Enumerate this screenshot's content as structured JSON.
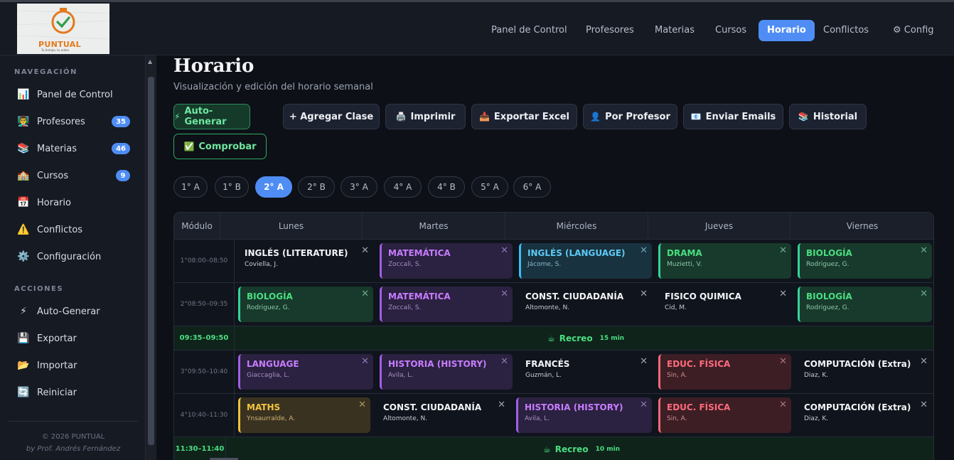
{
  "brand": {
    "name": "PUNTUAL",
    "tagline": "Tu tiempo, tu orden"
  },
  "topnav": [
    {
      "label": "Panel de Control",
      "active": false
    },
    {
      "label": "Profesores",
      "active": false
    },
    {
      "label": "Materias",
      "active": false
    },
    {
      "label": "Cursos",
      "active": false
    },
    {
      "label": "Horario",
      "active": true
    },
    {
      "label": "Conflictos",
      "active": false
    }
  ],
  "config": {
    "label": "Config",
    "icon": "gear-icon"
  },
  "sidebar": {
    "nav_title": "NAVEGACIÓN",
    "nav": [
      {
        "label": "Panel de Control",
        "icon": "chart-icon"
      },
      {
        "label": "Profesores",
        "icon": "teacher-icon",
        "badge": "35"
      },
      {
        "label": "Materias",
        "icon": "books-icon",
        "badge": "46"
      },
      {
        "label": "Cursos",
        "icon": "school-icon",
        "badge": "9"
      },
      {
        "label": "Horario",
        "icon": "calendar-icon"
      },
      {
        "label": "Conflictos",
        "icon": "warning-icon"
      },
      {
        "label": "Configuración",
        "icon": "gear-icon"
      }
    ],
    "actions_title": "ACCIONES",
    "actions": [
      {
        "label": "Auto-Generar",
        "icon": "lightning-icon"
      },
      {
        "label": "Exportar",
        "icon": "floppy-disk-icon"
      },
      {
        "label": "Importar",
        "icon": "folder-icon"
      },
      {
        "label": "Reiniciar",
        "icon": "refresh-icon"
      }
    ],
    "footer": {
      "copyright": "© 2026 PUNTUAL",
      "author": "by Prof. Andrés Fernández"
    }
  },
  "page": {
    "title": "Horario",
    "subtitle": "Visualización y edición del horario semanal"
  },
  "toolbar": [
    {
      "label": "Auto-Generar",
      "icon": "⚡",
      "style": "green"
    },
    {
      "label": "+ Agregar Clase",
      "icon": "",
      "style": "dark"
    },
    {
      "label": "Imprimir",
      "icon": "🖨️",
      "style": "dark"
    },
    {
      "label": "Exportar Excel",
      "icon": "📥",
      "style": "dark"
    },
    {
      "label": "Por Profesor",
      "icon": "👤",
      "style": "dark"
    },
    {
      "label": "Enviar Emails",
      "icon": "📧",
      "style": "dark"
    },
    {
      "label": "Historial",
      "icon": "📚",
      "style": "dark"
    },
    {
      "label": "Comprobar",
      "icon": "✅",
      "style": "greenout"
    }
  ],
  "courses": [
    {
      "label": "1° A",
      "active": false
    },
    {
      "label": "1° B",
      "active": false
    },
    {
      "label": "2° A",
      "active": true
    },
    {
      "label": "2° B",
      "active": false
    },
    {
      "label": "3° A",
      "active": false
    },
    {
      "label": "4° A",
      "active": false
    },
    {
      "label": "4° B",
      "active": false
    },
    {
      "label": "5° A",
      "active": false
    },
    {
      "label": "6° A",
      "active": false
    }
  ],
  "schedule": {
    "module_header": "Módulo",
    "days": [
      "Lunes",
      "Martes",
      "Miércoles",
      "Jueves",
      "Viernes"
    ],
    "rows": [
      {
        "type": "class",
        "time": "1°08:00–08:50",
        "cells": [
          {
            "subject": "INGLÉS (LITERATURE)",
            "teacher": "Coviella, J.",
            "color": "plain"
          },
          {
            "subject": "MATEMÁTICA",
            "teacher": "Zoccali, S.",
            "color": "purple"
          },
          {
            "subject": "INGLÉS (LANGUAGE)",
            "teacher": "Jácome, S.",
            "color": "teal"
          },
          {
            "subject": "DRAMA",
            "teacher": "Muzietti, V.",
            "color": "green"
          },
          {
            "subject": "BIOLOGÍA",
            "teacher": "Rodriguez, G.",
            "color": "green"
          }
        ]
      },
      {
        "type": "class",
        "time": "2°08:50–09:35",
        "cells": [
          {
            "subject": "BIOLOGÍA",
            "teacher": "Rodriguez, G.",
            "color": "green"
          },
          {
            "subject": "MATEMÁTICA",
            "teacher": "Zoccali, S.",
            "color": "purple"
          },
          {
            "subject": "CONST. CIUDADANÍA",
            "teacher": "Altomonte, N.",
            "color": "plain"
          },
          {
            "subject": "FISICO QUIMICA",
            "teacher": "Cid, M.",
            "color": "plain"
          },
          {
            "subject": "BIOLOGÍA",
            "teacher": "Rodriguez, G.",
            "color": "green"
          }
        ]
      },
      {
        "type": "break",
        "time": "09:35–09:50",
        "label": "Recreo",
        "minutes": "15 min"
      },
      {
        "type": "class",
        "time": "3°09:50–10:40",
        "cells": [
          {
            "subject": "LANGUAGE",
            "teacher": "Giaccaglia, L.",
            "color": "purple"
          },
          {
            "subject": "HISTORIA (HISTORY)",
            "teacher": "Avila, L.",
            "color": "purple"
          },
          {
            "subject": "FRANCÉS",
            "teacher": "Guzmán, L.",
            "color": "plain"
          },
          {
            "subject": "EDUC. FÍSICA",
            "teacher": "Sin, A.",
            "color": "red"
          },
          {
            "subject": "COMPUTACIÓN (Extra)",
            "teacher": "Diaz, K.",
            "color": "plain"
          }
        ]
      },
      {
        "type": "class",
        "time": "4°10:40–11:30",
        "cells": [
          {
            "subject": "MATHS",
            "teacher": "Ynsaurralde, A.",
            "color": "yellow"
          },
          {
            "subject": "CONST. CIUDADANÍA",
            "teacher": "Altomonte, N.",
            "color": "plain"
          },
          {
            "subject": "HISTORIA (HISTORY)",
            "teacher": "Avila, L.",
            "color": "purple"
          },
          {
            "subject": "EDUC. FÍSICA",
            "teacher": "Sin, A.",
            "color": "red"
          },
          {
            "subject": "COMPUTACIÓN (Extra)",
            "teacher": "Diaz, K.",
            "color": "plain"
          }
        ]
      },
      {
        "type": "break",
        "time": "11:30–11:40",
        "label": "Recreo",
        "minutes": "10 min"
      }
    ]
  }
}
